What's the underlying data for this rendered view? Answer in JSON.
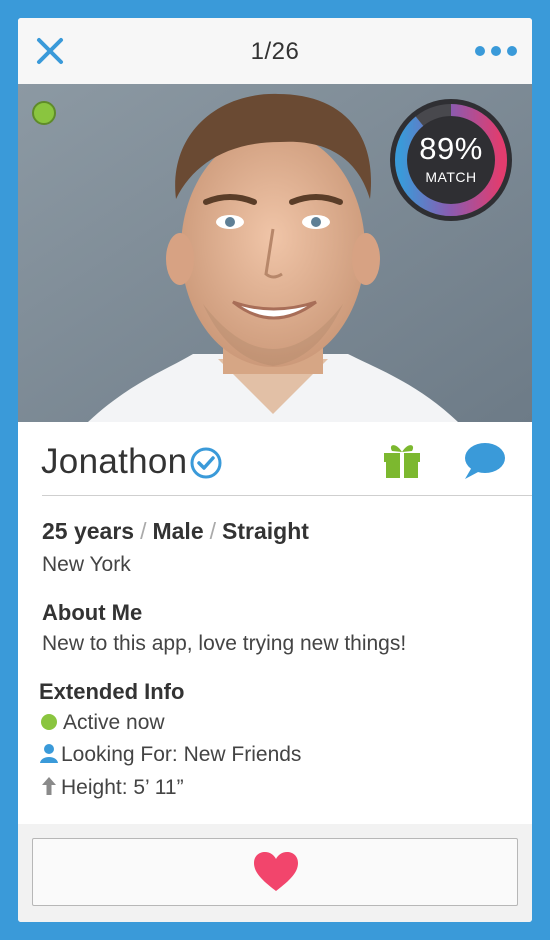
{
  "header": {
    "close_icon": "close-icon",
    "counter": "1/26",
    "more_icon": "more-dots-icon"
  },
  "profile": {
    "online": true,
    "match_percent": "89%",
    "match_label": "MATCH",
    "match_fraction": 0.89,
    "name": "Jonathon",
    "verified_icon": "verified-check-icon",
    "gift_icon": "gift-icon",
    "chat_icon": "chat-bubble-icon",
    "age": "25 years",
    "gender": "Male",
    "orientation": "Straight",
    "separator": "/",
    "city": "New York"
  },
  "about": {
    "title": "About Me",
    "text": "New to this app, love trying new things!"
  },
  "extended": {
    "title": "Extended Info",
    "active": "Active now",
    "looking_for": "Looking For: New Friends",
    "height": "Height: 5’ 11”"
  },
  "actions": {
    "like_icon": "heart-icon"
  },
  "colors": {
    "background": "#3a9ad9",
    "accent_blue": "#3a9ad9",
    "online_green": "#8ac53f",
    "gift_green": "#7cb82f",
    "heart_pink": "#f2456c"
  }
}
